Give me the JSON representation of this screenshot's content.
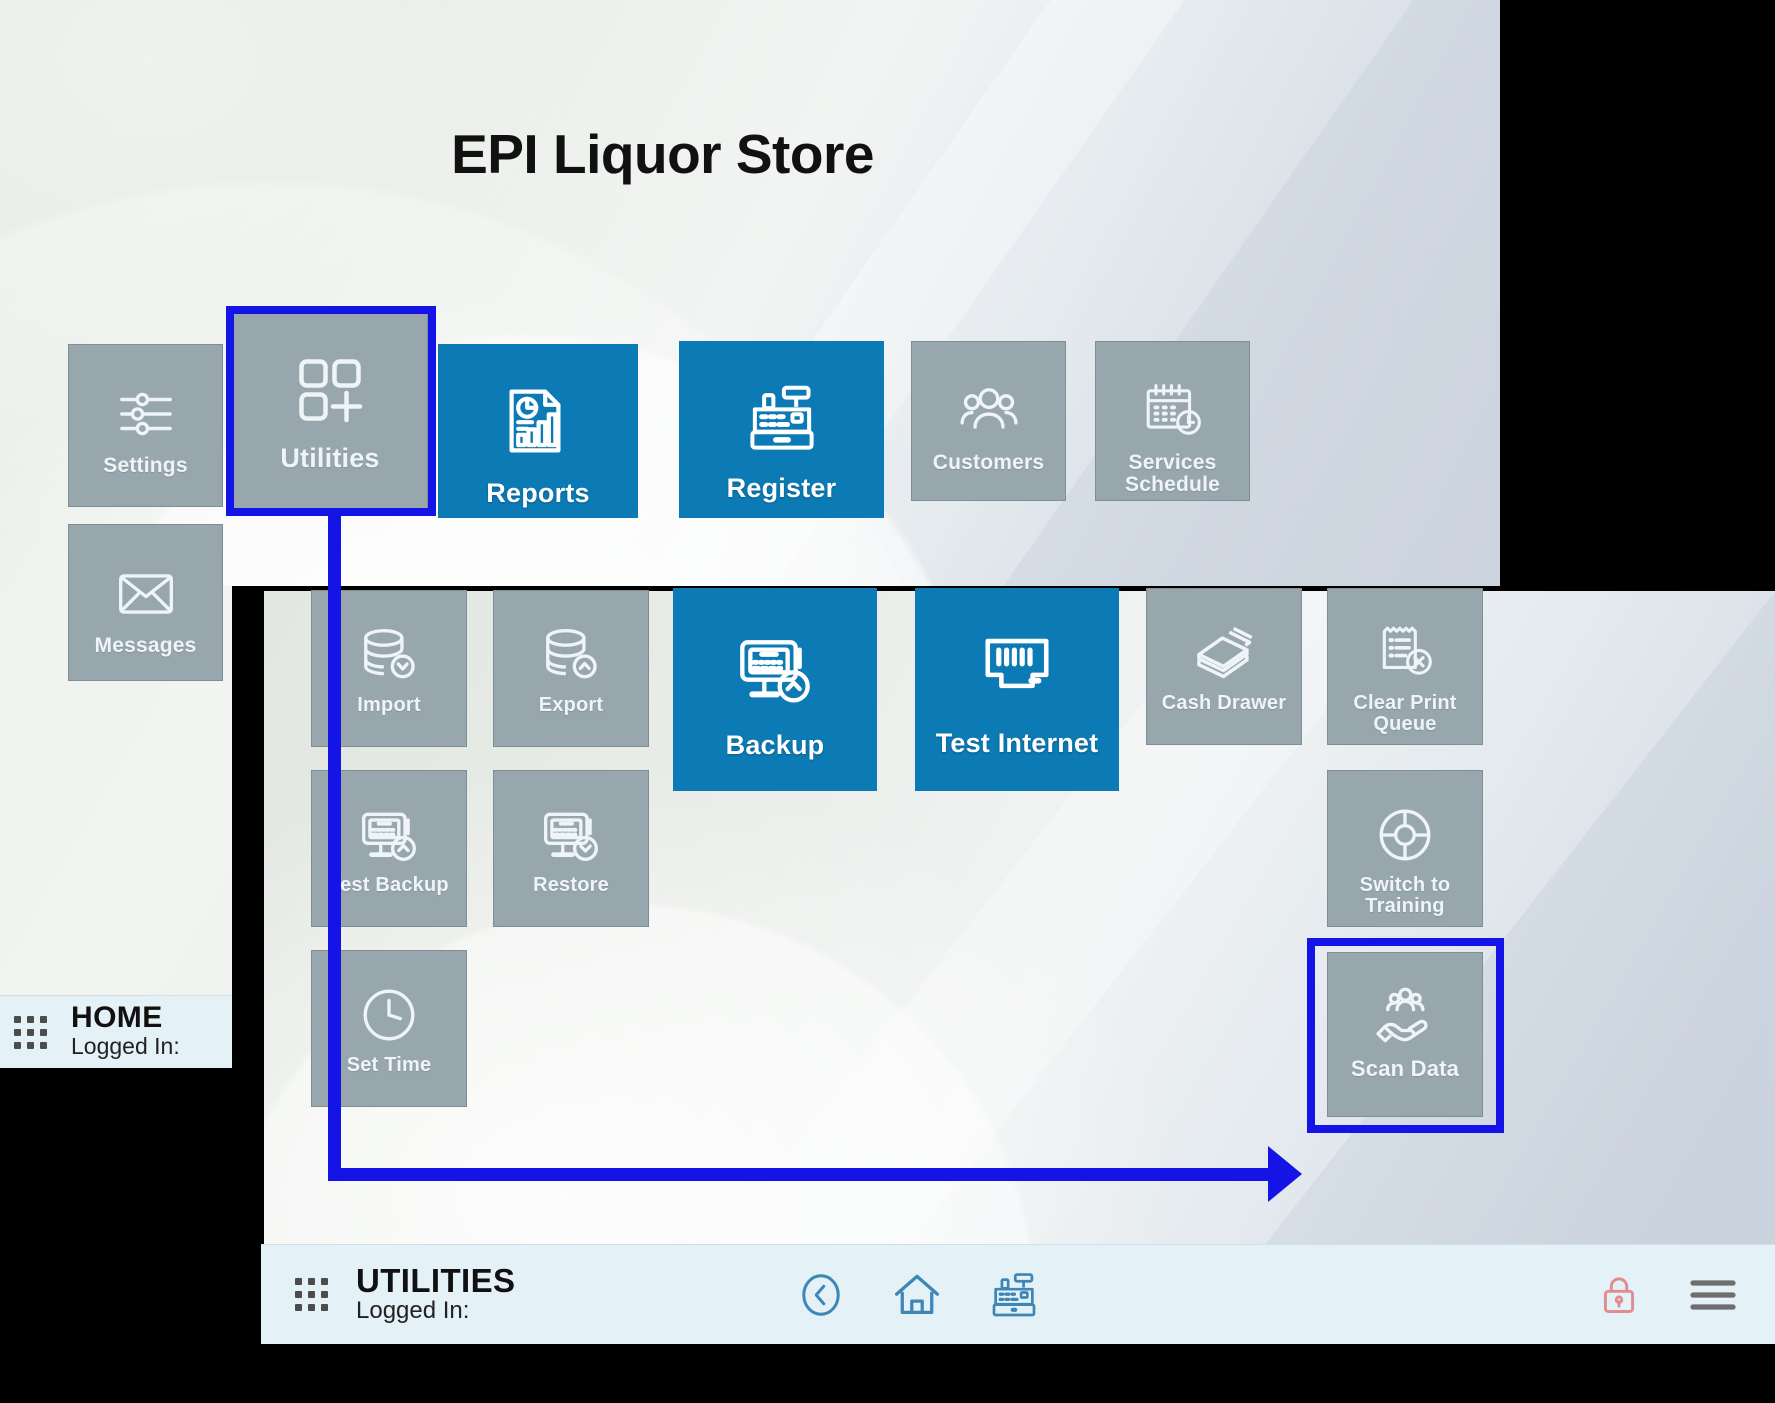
{
  "app": {
    "title": "EPI Liquor Store"
  },
  "home_menu": {
    "tiles": [
      {
        "label": "Settings",
        "icon": "sliders-icon",
        "style": "gray"
      },
      {
        "label": "Utilities",
        "icon": "grid-plus-icon",
        "style": "gray"
      },
      {
        "label": "Reports",
        "icon": "report-chart-icon",
        "style": "blue"
      },
      {
        "label": "Register",
        "icon": "cash-register-icon",
        "style": "blue"
      },
      {
        "label": "Customers",
        "icon": "people-group-icon",
        "style": "gray"
      },
      {
        "label": "Services Schedule",
        "icon": "calendar-clock-icon",
        "style": "gray"
      },
      {
        "label": "Messages",
        "icon": "envelope-icon",
        "style": "gray"
      }
    ]
  },
  "utilities_menu": {
    "tiles": [
      {
        "label": "Import",
        "icon": "database-down-icon",
        "style": "gray"
      },
      {
        "label": "Export",
        "icon": "database-up-icon",
        "style": "gray"
      },
      {
        "label": "Backup",
        "icon": "monitor-up-icon",
        "style": "blue"
      },
      {
        "label": "Test Internet",
        "icon": "ethernet-port-icon",
        "style": "blue"
      },
      {
        "label": "Cash Drawer",
        "icon": "cash-stack-icon",
        "style": "gray"
      },
      {
        "label": "Clear Print Queue",
        "icon": "receipt-cancel-icon",
        "style": "gray"
      },
      {
        "label": "Test Backup",
        "icon": "monitor-up-icon",
        "style": "gray"
      },
      {
        "label": "Restore",
        "icon": "monitor-down-icon",
        "style": "gray"
      },
      {
        "label": "Switch to Training",
        "icon": "life-ring-icon",
        "style": "gray"
      },
      {
        "label": "Set Time",
        "icon": "clock-icon",
        "style": "gray"
      },
      {
        "label": "Scan Data",
        "icon": "hand-people-icon",
        "style": "gray"
      }
    ]
  },
  "home_statusbar": {
    "menu_icon": "app-grid-icon",
    "title": "HOME",
    "logged_in_label": "Logged In:",
    "logged_in_value": ""
  },
  "utilities_statusbar": {
    "menu_icon": "app-grid-icon",
    "title": "UTILITIES",
    "logged_in_label": "Logged In:",
    "logged_in_value": "",
    "icons": [
      {
        "name": "back-icon"
      },
      {
        "name": "home-icon"
      },
      {
        "name": "register-icon"
      },
      {
        "name": "lock-icon"
      },
      {
        "name": "hamburger-menu-icon"
      }
    ]
  },
  "annotations": {
    "highlight_color": "#1414E6",
    "highlighted": [
      "Utilities",
      "Scan Data"
    ],
    "arrow": "from Utilities tile down and right to Scan Data tile"
  }
}
